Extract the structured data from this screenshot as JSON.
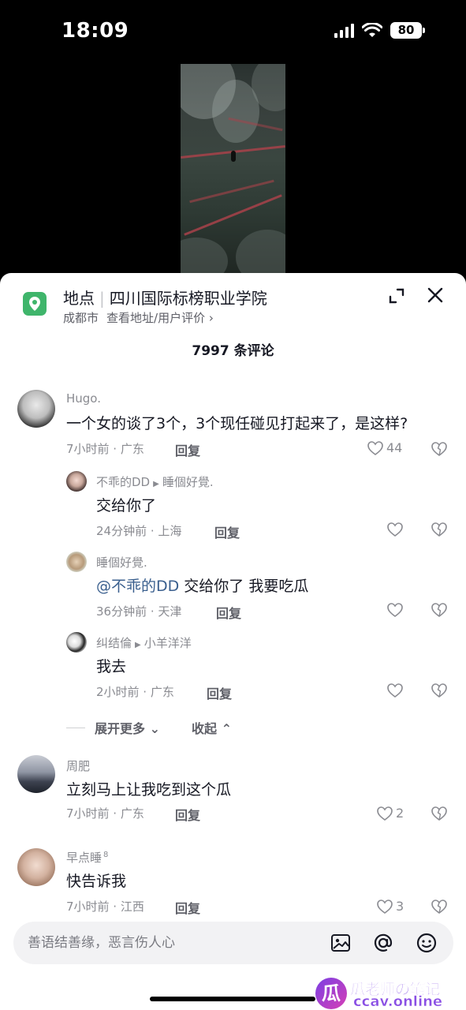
{
  "status_bar": {
    "time": "18:09",
    "battery": "80"
  },
  "location": {
    "label": "地点",
    "name": "四川国际标榜职业学院",
    "city": "成都市",
    "link": "查看地址/用户评价 ›"
  },
  "comment_count": "7997 条评论",
  "comments": [
    {
      "user": "Hugo.",
      "text": "一个女的谈了3个，3个现任碰见打起来了，是这样?",
      "meta": "7小时前 · 广东",
      "reply": "回复",
      "likes": "44"
    },
    {
      "user": "不乖的DD",
      "reply_to": "睡個好覺.",
      "text": "交给你了",
      "meta": "24分钟前 · 上海",
      "reply": "回复"
    },
    {
      "user": "睡個好覺.",
      "mention": "@不乖的DD",
      "text": " 交给你了 我要吃瓜",
      "meta": "36分钟前 · 天津",
      "reply": "回复"
    },
    {
      "user": "纠结倫",
      "reply_to": "小羊洋洋",
      "text": "我去",
      "meta": "2小时前 · 广东",
      "reply": "回复"
    },
    {
      "user": "周肥",
      "text": "立刻马上让我吃到这个瓜",
      "meta": "7小时前 · 广东",
      "reply": "回复",
      "likes": "2"
    },
    {
      "user": "早点睡",
      "badge": "8",
      "text": "快告诉我",
      "meta": "7小时前 · 江西",
      "reply": "回复",
      "likes": "3"
    }
  ],
  "expand": {
    "more": "展开更多",
    "collapse": "收起"
  },
  "input": {
    "placeholder": "善语结善缘，恶言伤人心"
  },
  "watermark": {
    "logo": "瓜",
    "title": "瓜老师の笔记",
    "site": "ccav.online"
  }
}
